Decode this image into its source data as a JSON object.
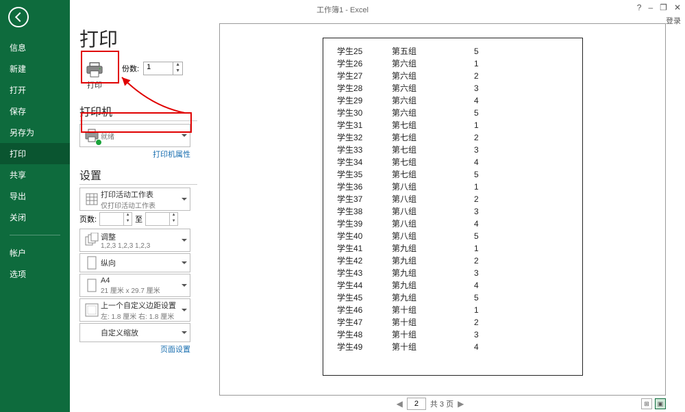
{
  "titlebar": {
    "title": "工作簿1 - Excel",
    "login": "登录"
  },
  "sidebar": {
    "items": [
      "信息",
      "新建",
      "打开",
      "保存",
      "另存为",
      "打印",
      "共享",
      "导出",
      "关闭"
    ],
    "items2": [
      "帐户",
      "选项"
    ],
    "active_index": 5
  },
  "page": {
    "title": "打印"
  },
  "print_button": {
    "label": "打印"
  },
  "copies": {
    "label": "份数:",
    "value": "1"
  },
  "printer": {
    "heading": "打印机",
    "name": "",
    "status": "就绪",
    "properties_link": "打印机属性"
  },
  "settings": {
    "heading": "设置",
    "scope": {
      "title": "打印活动工作表",
      "subtitle": "仅打印活动工作表"
    },
    "pages": {
      "label": "页数:",
      "from": "",
      "to_label": "至",
      "to": ""
    },
    "collate": {
      "title": "调整",
      "subtitle": "1,2,3   1,2,3   1,2,3"
    },
    "orientation": {
      "title": "纵向",
      "subtitle": ""
    },
    "paper": {
      "title": "A4",
      "subtitle": "21 厘米 x 29.7 厘米"
    },
    "margins": {
      "title": "上一个自定义边距设置",
      "subtitle": "左: 1.8 厘米  右: 1.8 厘米"
    },
    "scaling": {
      "title": "自定义缩放",
      "subtitle": ""
    },
    "page_setup_link": "页面设置"
  },
  "preview": {
    "rows": [
      {
        "a": "学生25",
        "b": "第五组",
        "c": "5"
      },
      {
        "a": "学生26",
        "b": "第六组",
        "c": "1"
      },
      {
        "a": "学生27",
        "b": "第六组",
        "c": "2"
      },
      {
        "a": "学生28",
        "b": "第六组",
        "c": "3"
      },
      {
        "a": "学生29",
        "b": "第六组",
        "c": "4"
      },
      {
        "a": "学生30",
        "b": "第六组",
        "c": "5"
      },
      {
        "a": "学生31",
        "b": "第七组",
        "c": "1"
      },
      {
        "a": "学生32",
        "b": "第七组",
        "c": "2"
      },
      {
        "a": "学生33",
        "b": "第七组",
        "c": "3"
      },
      {
        "a": "学生34",
        "b": "第七组",
        "c": "4"
      },
      {
        "a": "学生35",
        "b": "第七组",
        "c": "5"
      },
      {
        "a": "学生36",
        "b": "第八组",
        "c": "1"
      },
      {
        "a": "学生37",
        "b": "第八组",
        "c": "2"
      },
      {
        "a": "学生38",
        "b": "第八组",
        "c": "3"
      },
      {
        "a": "学生39",
        "b": "第八组",
        "c": "4"
      },
      {
        "a": "学生40",
        "b": "第八组",
        "c": "5"
      },
      {
        "a": "学生41",
        "b": "第九组",
        "c": "1"
      },
      {
        "a": "学生42",
        "b": "第九组",
        "c": "2"
      },
      {
        "a": "学生43",
        "b": "第九组",
        "c": "3"
      },
      {
        "a": "学生44",
        "b": "第九组",
        "c": "4"
      },
      {
        "a": "学生45",
        "b": "第九组",
        "c": "5"
      },
      {
        "a": "学生46",
        "b": "第十组",
        "c": "1"
      },
      {
        "a": "学生47",
        "b": "第十组",
        "c": "2"
      },
      {
        "a": "学生48",
        "b": "第十组",
        "c": "3"
      },
      {
        "a": "学生49",
        "b": "第十组",
        "c": "4"
      }
    ],
    "footer": {
      "current": "2",
      "total_label": "共 3 页"
    }
  }
}
